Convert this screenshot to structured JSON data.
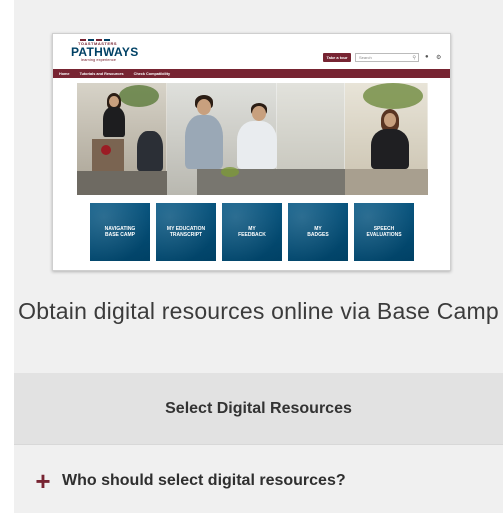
{
  "colors": {
    "brand_maroon": "#772432",
    "brand_blue": "#004165",
    "card_bg": "#f0f0f0",
    "bar_bg": "#e2e2e2"
  },
  "preview": {
    "logo": {
      "top": "TOASTMASTERS",
      "main": "PATHWAYS",
      "sub": "learning experience"
    },
    "tour_label": "Take a tour",
    "search_placeholder": "Search",
    "nav": [
      "Home",
      "Tutorials and Resources",
      "Check Compatibility"
    ],
    "tiles": [
      "NAVIGATING\nBASE CAMP",
      "MY EDUCATION\nTRANSCRIPT",
      "MY\nFEEDBACK",
      "MY\nBADGES",
      "SPEECH\nEVALUATIONS"
    ]
  },
  "title": "Obtain digital resources online via Base Camp",
  "select_label": "Select Digital Resources",
  "accordion": {
    "icon": "plus-icon",
    "label": "Who should select digital resources?"
  }
}
